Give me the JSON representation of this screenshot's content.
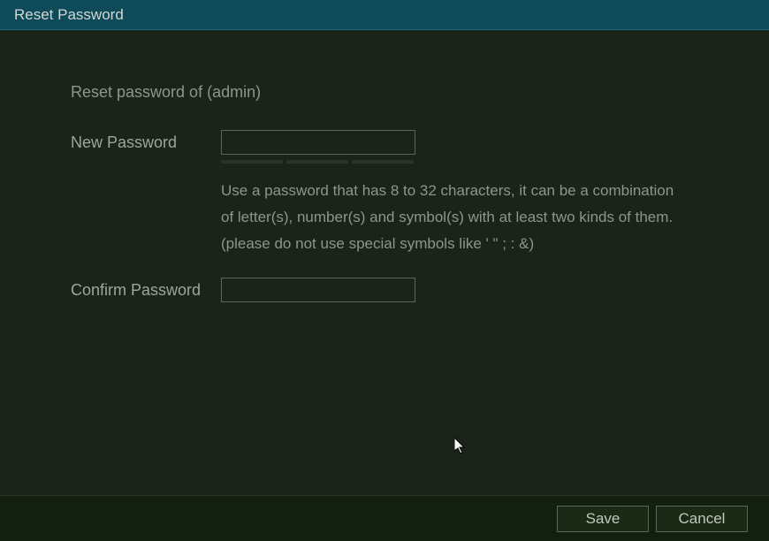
{
  "titlebar": {
    "title": "Reset Password"
  },
  "form": {
    "subtitle": "Reset password of (admin)",
    "new_password_label": "New Password",
    "new_password_value": "",
    "help_text": "Use a password that has 8 to 32 characters, it can be a combination of letter(s), number(s) and symbol(s) with at least two kinds of them.(please do not use special symbols like ' \" ; : &)",
    "confirm_password_label": "Confirm Password",
    "confirm_password_value": ""
  },
  "buttons": {
    "save": "Save",
    "cancel": "Cancel"
  }
}
